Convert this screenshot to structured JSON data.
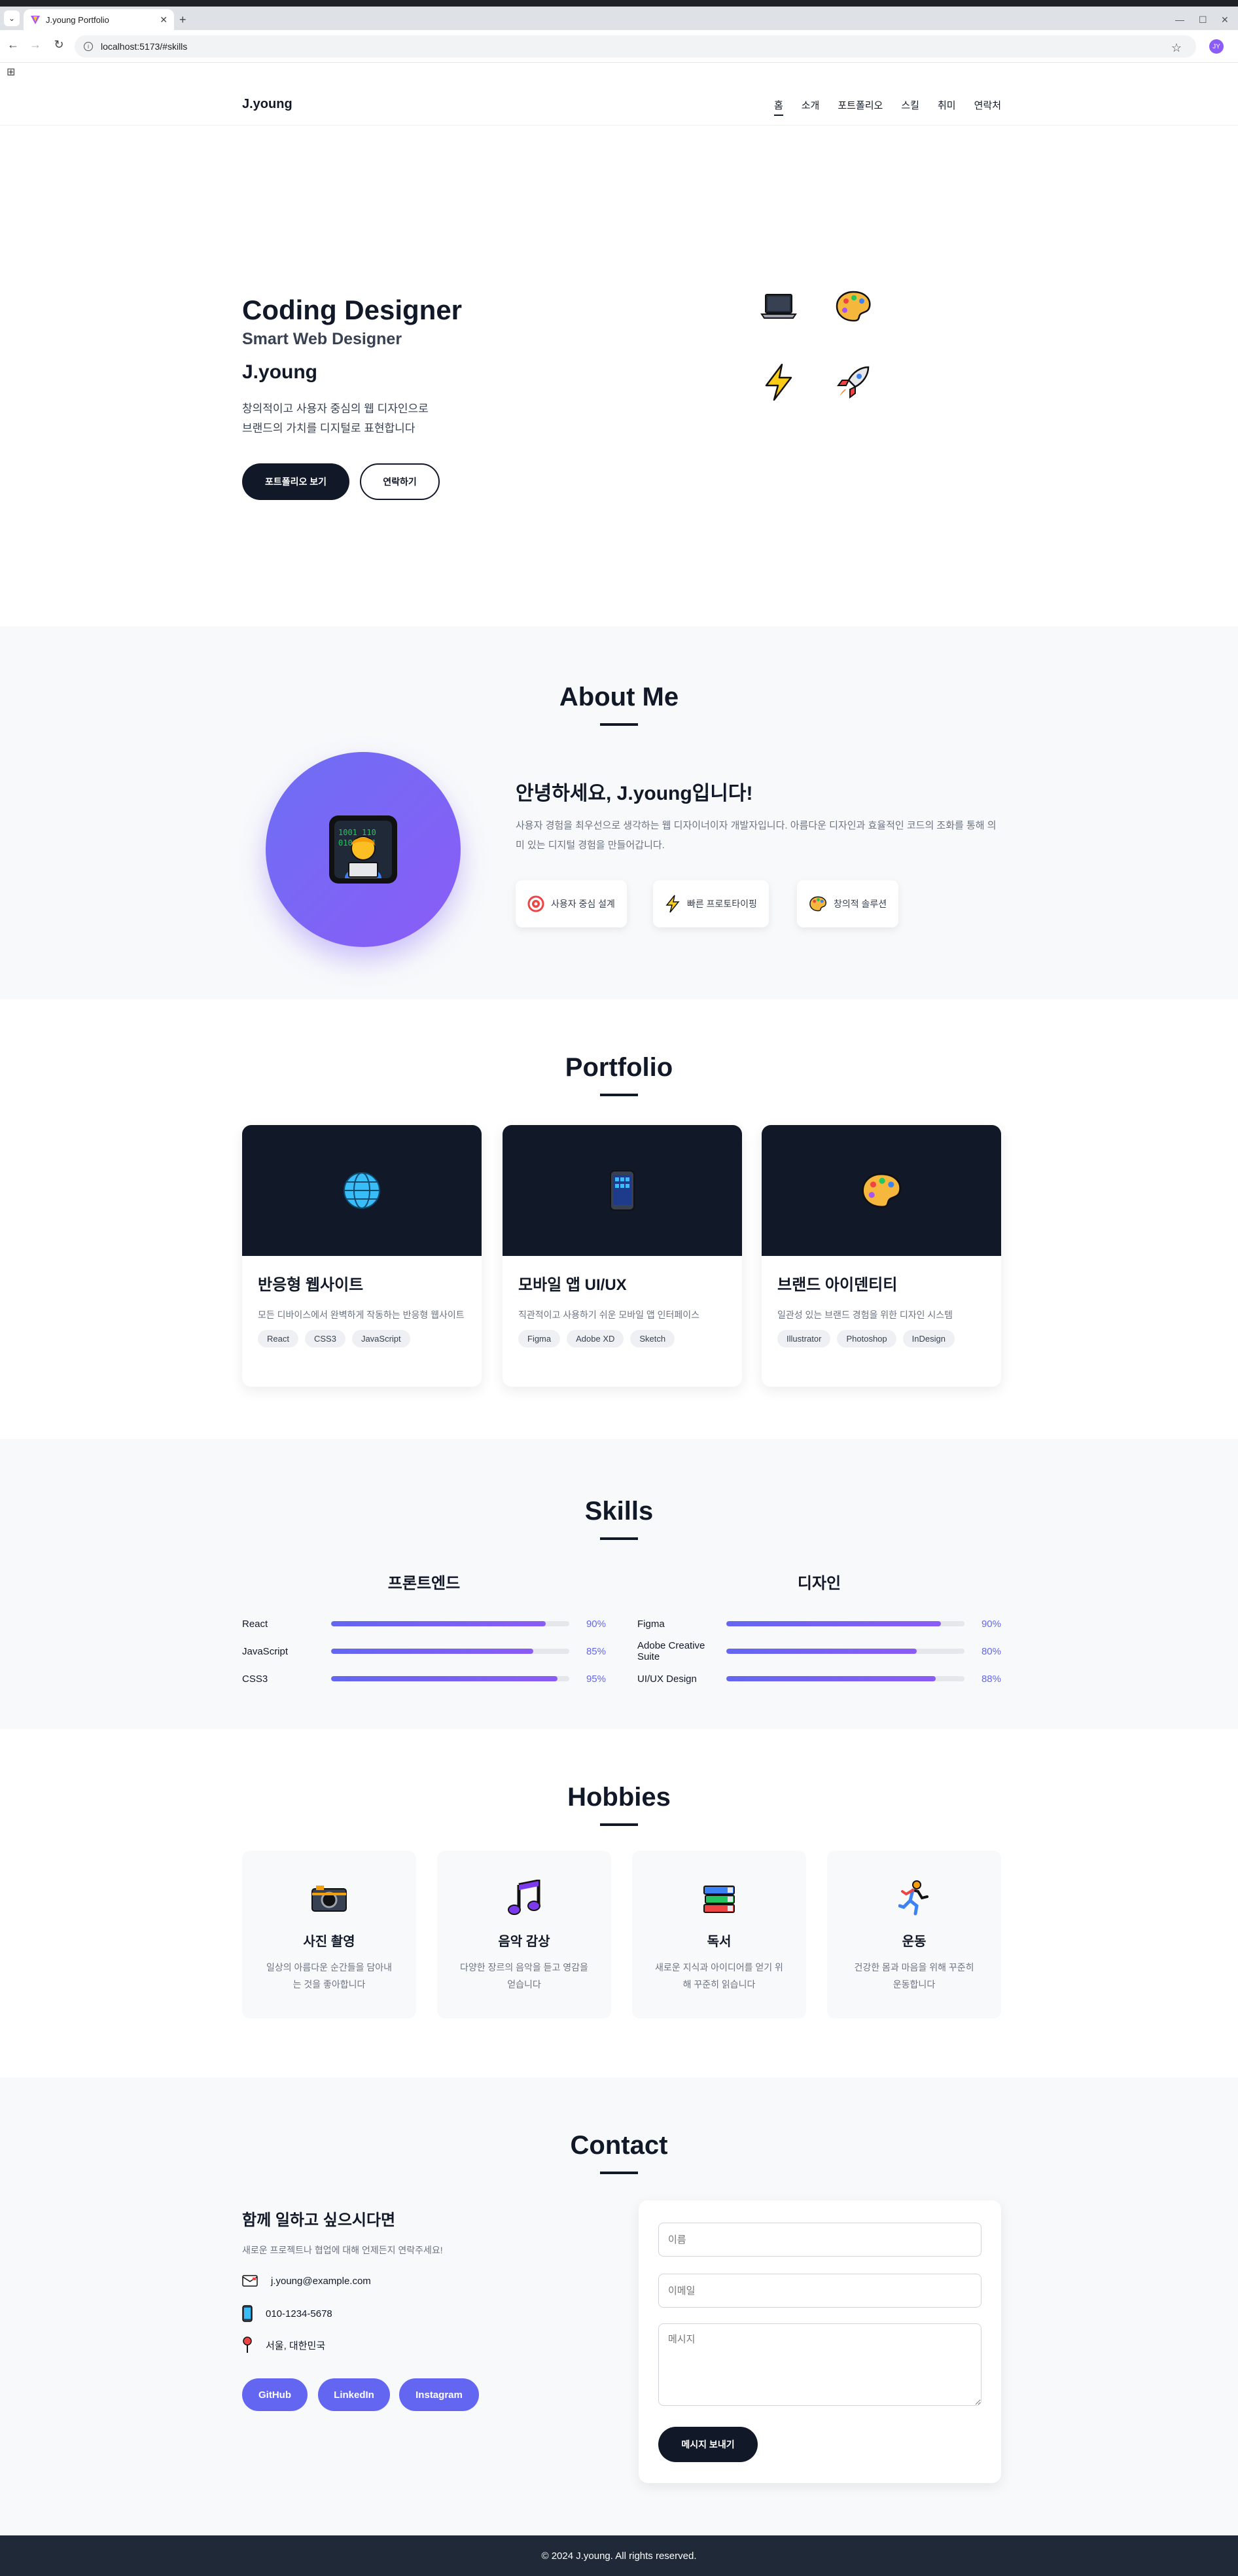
{
  "browser": {
    "tab_title": "J.young Portfolio",
    "url": "localhost:5173/#skills",
    "profile_initial": "JY"
  },
  "nav": {
    "logo": "J.young",
    "items": [
      "홈",
      "소개",
      "포트폴리오",
      "스킬",
      "취미",
      "연락처"
    ],
    "active": "홈"
  },
  "hero": {
    "title": "Coding Designer",
    "subtitle": "Smart Web Designer",
    "name": "J.young",
    "desc_line1": "창의적이고 사용자 중심의 웹 디자인으로",
    "desc_line2": "브랜드의 가치를 디지털로 표현합니다",
    "primary_btn": "포트폴리오 보기",
    "secondary_btn": "연락하기",
    "icons": [
      "laptop-icon",
      "palette-icon",
      "lightning-icon",
      "rocket-icon"
    ]
  },
  "about": {
    "title": "About Me",
    "heading": "안녕하세요, J.young입니다!",
    "desc": "사용자 경험을 최우선으로 생각하는 웹 디자이너이자 개발자입니다. 아름다운 디자인과 효율적인 코드의 조화를 통해 의미 있는 디지털 경험을 만들어갑니다.",
    "chips": [
      {
        "icon": "target-icon",
        "label": "사용자 중심 설계"
      },
      {
        "icon": "lightning-icon",
        "label": "빠른 프로토타이핑"
      },
      {
        "icon": "palette-icon",
        "label": "창의적 솔루션"
      }
    ]
  },
  "portfolio": {
    "title": "Portfolio",
    "cards": [
      {
        "icon": "globe-icon",
        "title": "반응형 웹사이트",
        "desc": "모든 디바이스에서 완벽하게 작동하는 반응형 웹사이트",
        "tags": [
          "React",
          "CSS3",
          "JavaScript"
        ]
      },
      {
        "icon": "mobile-phone-icon",
        "title": "모바일 앱 UI/UX",
        "desc": "직관적이고 사용하기 쉬운 모바일 앱 인터페이스",
        "tags": [
          "Figma",
          "Adobe XD",
          "Sketch"
        ]
      },
      {
        "icon": "palette-icon",
        "title": "브랜드 아이덴티티",
        "desc": "일관성 있는 브랜드 경험을 위한 디자인 시스템",
        "tags": [
          "Illustrator",
          "Photoshop",
          "InDesign"
        ]
      }
    ]
  },
  "skills": {
    "title": "Skills",
    "groups": [
      {
        "title": "프론트엔드",
        "items": [
          {
            "label": "React",
            "pct": "90%",
            "value": 90
          },
          {
            "label": "JavaScript",
            "pct": "85%",
            "value": 85
          },
          {
            "label": "CSS3",
            "pct": "95%",
            "value": 95
          }
        ]
      },
      {
        "title": "디자인",
        "items": [
          {
            "label": "Figma",
            "pct": "90%",
            "value": 90
          },
          {
            "label": "Adobe Creative Suite",
            "pct": "80%",
            "value": 80
          },
          {
            "label": "UI/UX Design",
            "pct": "88%",
            "value": 88
          }
        ]
      }
    ]
  },
  "hobbies": {
    "title": "Hobbies",
    "items": [
      {
        "icon": "camera-icon",
        "title": "사진 촬영",
        "desc": "일상의 아름다운 순간들을 담아내는 것을 좋아합니다"
      },
      {
        "icon": "music-note-icon",
        "title": "음악 감상",
        "desc": "다양한 장르의 음악을 듣고 영감을 얻습니다"
      },
      {
        "icon": "books-icon",
        "title": "독서",
        "desc": "새로운 지식과 아이디어를 얻기 위해 꾸준히 읽습니다"
      },
      {
        "icon": "running-icon",
        "title": "운동",
        "desc": "건강한 몸과 마음을 위해 꾸준히 운동합니다"
      }
    ]
  },
  "contact": {
    "title": "Contact",
    "heading": "함께 일하고 싶으시다면",
    "desc": "새로운 프로젝트나 협업에 대해 언제든지 연락주세요!",
    "email": "j.young@example.com",
    "phone": "010-1234-5678",
    "location": "서울, 대한민국",
    "socials": [
      "GitHub",
      "LinkedIn",
      "Instagram"
    ],
    "form": {
      "name_placeholder": "이름",
      "email_placeholder": "이메일",
      "message_placeholder": "메시지",
      "submit": "메시지 보내기"
    }
  },
  "footer": {
    "text": "© 2024 J.young. All rights reserved."
  },
  "colors": {
    "accent": "#6366f1",
    "accent2": "#8b5cf6",
    "dark": "#111827"
  }
}
